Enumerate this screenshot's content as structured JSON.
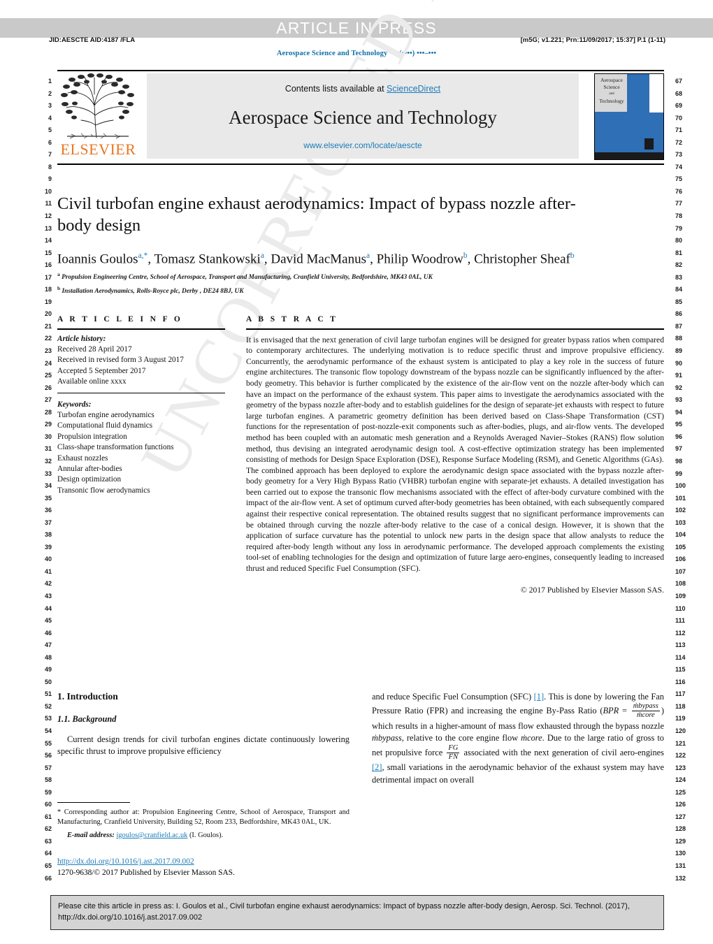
{
  "banner": {
    "press_text": "ARTICLE IN PRESS"
  },
  "runheads": {
    "left": "JID:AESCTE   AID:4187 /FLA",
    "right": "[m5G; v1.221; Prn:11/09/2017; 15:37] P.1 (1-11)",
    "journal_running": "Aerospace Science and Technology ••• (••••) •••–•••"
  },
  "masthead": {
    "publisher": "ELSEVIER",
    "contents_prefix": "Contents lists available at ",
    "contents_link": "ScienceDirect",
    "journal_title": "Aerospace Science and Technology",
    "journal_url": "www.elsevier.com/locate/aescte",
    "cover_line1": "Aerospace",
    "cover_line2": "Science",
    "cover_line3": "and",
    "cover_line4": "Technology"
  },
  "title": "Civil turbofan engine exhaust aerodynamics: Impact of bypass nozzle after-body design",
  "authors": [
    {
      "name": "Ioannis Goulos",
      "marks": "a,*"
    },
    {
      "name": "Tomasz Stankowski",
      "marks": "a"
    },
    {
      "name": "David MacManus",
      "marks": "a"
    },
    {
      "name": "Philip Woodrow",
      "marks": "b"
    },
    {
      "name": "Christopher Sheaf",
      "marks": "b"
    }
  ],
  "affiliations": [
    {
      "mark": "a",
      "text": "Propulsion Engineering Centre, School of Aerospace, Transport and Manufacturing, Cranfield University, Bedfordshire, MK43 0AL, UK"
    },
    {
      "mark": "b",
      "text": "Installation Aerodynamics, Rolls-Royce plc, Derby , DE24 8BJ, UK"
    }
  ],
  "article_info": {
    "heading": "A R T I C L E   I N F O",
    "history_label": "Article history:",
    "history": [
      "Received 28 April 2017",
      "Received in revised form 3 August 2017",
      "Accepted 5 September 2017",
      "Available online xxxx"
    ],
    "keywords_label": "Keywords:",
    "keywords": [
      "Turbofan engine aerodynamics",
      "Computational fluid dynamics",
      "Propulsion integration",
      "Class-shape transformation functions",
      "Exhaust nozzles",
      "Annular after-bodies",
      "Design optimization",
      "Transonic flow aerodynamics"
    ]
  },
  "abstract": {
    "heading": "A B S T R A C T",
    "paragraphs": [
      "It is envisaged that the next generation of civil large turbofan engines will be designed for greater bypass ratios when compared to contemporary architectures. The underlying motivation is to reduce specific thrust and improve propulsive efficiency. Concurrently, the aerodynamic performance of the exhaust system is anticipated to play a key role in the success of future engine architectures. The transonic flow topology downstream of the bypass nozzle can be significantly influenced by the after-body geometry. This behavior is further complicated by the existence of the air-flow vent on the nozzle after-body which can have an impact on the performance of the exhaust system. This paper aims to investigate the aerodynamics associated with the geometry of the bypass nozzle after-body and to establish guidelines for the design of separate-jet exhausts with respect to future large turbofan engines. A parametric geometry definition has been derived based on Class-Shape Transformation (CST) functions for the representation of post-nozzle-exit components such as after-bodies, plugs, and air-flow vents. The developed method has been coupled with an automatic mesh generation and a Reynolds Averaged Navier–Stokes (RANS) flow solution method, thus devising an integrated aerodynamic design tool. A cost-effective optimization strategy has been implemented consisting of methods for Design Space Exploration (DSE), Response Surface Modeling (RSM), and Genetic Algorithms (GAs).",
      "The combined approach has been deployed to explore the aerodynamic design space associated with the bypass nozzle after-body geometry for a Very High Bypass Ratio (VHBR) turbofan engine with separate-jet exhausts. A detailed investigation has been carried out to expose the transonic flow mechanisms associated with the effect of after-body curvature combined with the impact of the air-flow vent. A set of optimum curved after-body geometries has been obtained, with each subsequently compared against their respective conical representation. The obtained results suggest that no significant performance improvements can be obtained through curving the nozzle after-body relative to the case of a conical design. However, it is shown that the application of surface curvature has the potential to unlock new parts in the design space that allow analysts to reduce the required after-body length without any loss in aerodynamic performance. The developed approach complements the existing tool-set of enabling technologies for the design and optimization of future large aero-engines, consequently leading to increased thrust and reduced Specific Fuel Consumption (SFC)."
    ],
    "copyright": "© 2017 Published by Elsevier Masson SAS."
  },
  "body": {
    "section_heading": "1. Introduction",
    "subsection_heading": "1.1. Background",
    "left_paragraph": "Current design trends for civil turbofan engines dictate continuously lowering specific thrust to improve propulsive efficiency",
    "right_text_1": "and reduce Specific Fuel Consumption (SFC) ",
    "right_ref_1": "[1]",
    "right_text_2": ". This is done by lowering the Fan Pressure Ratio (FPR) and increasing the engine By-Pass Ratio (",
    "bpr_symbol": "BPR",
    "bpr_equals": " = ",
    "bpr_num": "ṁbypass",
    "bpr_den": "ṁcore",
    "right_text_3": ") which results in a higher-amount of mass flow exhausted through the bypass nozzle ",
    "mdot_bypass": "ṁbypass",
    "right_text_4": ", relative to the core engine flow ",
    "mdot_core": "ṁcore",
    "right_text_5": ". Due to the large ratio of gross to net propulsive force ",
    "fg_num": "FG",
    "fn_den": "FN",
    "right_text_6": " associated with the next generation of civil aero-engines ",
    "right_ref_2": "[2]",
    "right_text_7": ", small variations in the aerodynamic behavior of the exhaust system may have detrimental impact on overall"
  },
  "footnote": {
    "star": "*",
    "text": "Corresponding author at: Propulsion Engineering Centre, School of Aerospace, Transport and Manufacturing, Cranfield University, Building 52, Room 233, Bedfordshire, MK43 0AL, UK.",
    "email_label": "E-mail address:",
    "email": "igoulos@cranfield.ac.uk",
    "email_suffix": "(I. Goulos)."
  },
  "doi_block": {
    "doi_url": "http://dx.doi.org/10.1016/j.ast.2017.09.002",
    "issn_line": "1270-9638/© 2017 Published by Elsevier Masson SAS."
  },
  "cite_box": {
    "line1": "Please cite this article in press as: I. Goulos et al., Civil turbofan engine exhaust aerodynamics: Impact of bypass nozzle after-body design, Aerosp. Sci. Technol. (2017),",
    "line2": "http://dx.doi.org/10.1016/j.ast.2017.09.002"
  },
  "watermark": {
    "text": "UNCORRECTED PROOF"
  },
  "line_numbers": {
    "left_start": 1,
    "left_end": 66,
    "right_start": 67,
    "right_end": 132
  },
  "colors": {
    "link": "#1a7bb9",
    "elsevier_orange": "#e87722",
    "banner_grey": "#c9c9c9",
    "cite_box_grey": "#d4d4d4"
  }
}
